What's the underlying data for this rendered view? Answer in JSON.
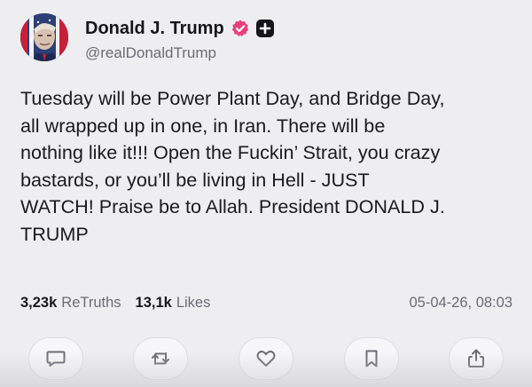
{
  "post": {
    "author": {
      "display_name": "Donald J. Trump",
      "handle": "@realDonaldTrump",
      "verified_color": "#e9407a",
      "avatar_icon": "avatar-photo",
      "badge_icon": "plus-badge-icon"
    },
    "text": "Tuesday will be Power Plant Day, and Bridge Day,\nall wrapped up in one, in Iran. There will be\nnothing like it!!! Open the Fuckin’ Strait, you crazy\nbastards, or you’ll be living in Hell - JUST\nWATCH! Praise be to Allah. President DONALD J.\nTRUMP",
    "stats": {
      "retruths_value": "3,23k",
      "retruths_label": "ReTruths",
      "likes_value": "13,1k",
      "likes_label": "Likes"
    },
    "timestamp": "05-04-26, 08:03",
    "actions": [
      {
        "icon": "comment-icon"
      },
      {
        "icon": "retruth-icon"
      },
      {
        "icon": "heart-icon"
      },
      {
        "icon": "bookmark-icon"
      },
      {
        "icon": "share-icon"
      }
    ]
  }
}
